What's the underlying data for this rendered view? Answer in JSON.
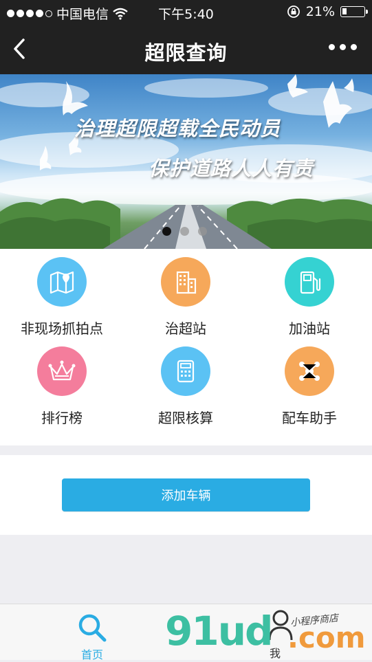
{
  "status_bar": {
    "carrier": "中国电信",
    "time": "下午5:40",
    "battery": "21%",
    "battery_level": 0.21
  },
  "nav": {
    "title": "超限查询"
  },
  "banner": {
    "slogan_line1": "治理超限超载全民动员",
    "slogan_line2": "保护道路人人有责",
    "active_slide": 1,
    "slide_count": 3
  },
  "grid": {
    "items": [
      {
        "label": "非现场抓拍点",
        "icon": "map-pin-icon",
        "color": "#5bc2f4"
      },
      {
        "label": "治超站",
        "icon": "building-icon",
        "color": "#f6a85a"
      },
      {
        "label": "加油站",
        "icon": "fuel-pump-icon",
        "color": "#35d2d2"
      },
      {
        "label": "排行榜",
        "icon": "crown-icon",
        "color": "#f47d9c"
      },
      {
        "label": "超限核算",
        "icon": "calculator-icon",
        "color": "#5bc2f4"
      },
      {
        "label": "配车助手",
        "icon": "share-nodes-icon",
        "color": "#f6a85a"
      }
    ]
  },
  "actions": {
    "add_vehicle_label": "添加车辆"
  },
  "tabbar": {
    "home_label": "首页",
    "me_label": "我",
    "active": "home"
  },
  "watermark": {
    "brand": "91ud",
    "domain": ".com",
    "tagline": "小程序商店"
  }
}
